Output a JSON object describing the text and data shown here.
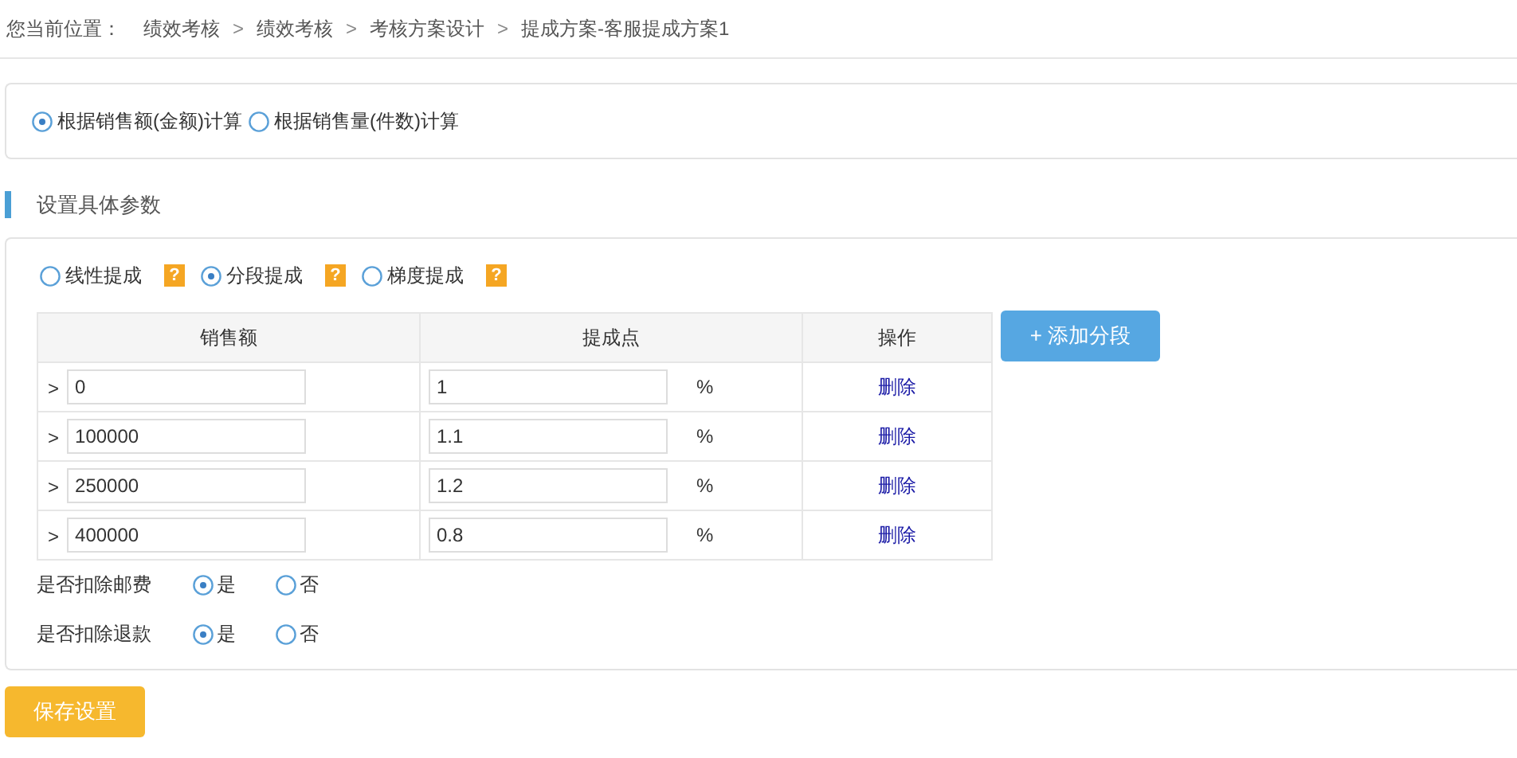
{
  "breadcrumb": {
    "label": "您当前位置：",
    "separator": ">",
    "items": [
      "绩效考核",
      "绩效考核",
      "考核方案设计",
      "提成方案-客服提成方案1"
    ]
  },
  "calc_basis": [
    {
      "label": "根据销售额(金额)计算",
      "selected": true
    },
    {
      "label": "根据销售量(件数)计算",
      "selected": false
    }
  ],
  "section_title": "设置具体参数",
  "commission_types": [
    {
      "label": "线性提成",
      "selected": false,
      "help": "?"
    },
    {
      "label": "分段提成",
      "selected": true,
      "help": "?"
    },
    {
      "label": "梯度提成",
      "selected": false,
      "help": "?"
    }
  ],
  "table": {
    "columns": [
      "销售额",
      "提成点",
      "操作"
    ],
    "rows": [
      {
        "prefix": ">",
        "sales": "0",
        "rate": "1",
        "unit": "%",
        "action": "删除"
      },
      {
        "prefix": ">",
        "sales": "100000",
        "rate": "1.1",
        "unit": "%",
        "action": "删除"
      },
      {
        "prefix": ">",
        "sales": "250000",
        "rate": "1.2",
        "unit": "%",
        "action": "删除"
      },
      {
        "prefix": ">",
        "sales": "400000",
        "rate": "0.8",
        "unit": "%",
        "action": "删除"
      }
    ]
  },
  "add_button": "+ 添加分段",
  "options": [
    {
      "label": "是否扣除邮费",
      "choices": [
        {
          "label": "是",
          "selected": true
        },
        {
          "label": "否",
          "selected": false
        }
      ]
    },
    {
      "label": "是否扣除退款",
      "choices": [
        {
          "label": "是",
          "selected": true
        },
        {
          "label": "否",
          "selected": false
        }
      ]
    }
  ],
  "save_button": "保存设置"
}
